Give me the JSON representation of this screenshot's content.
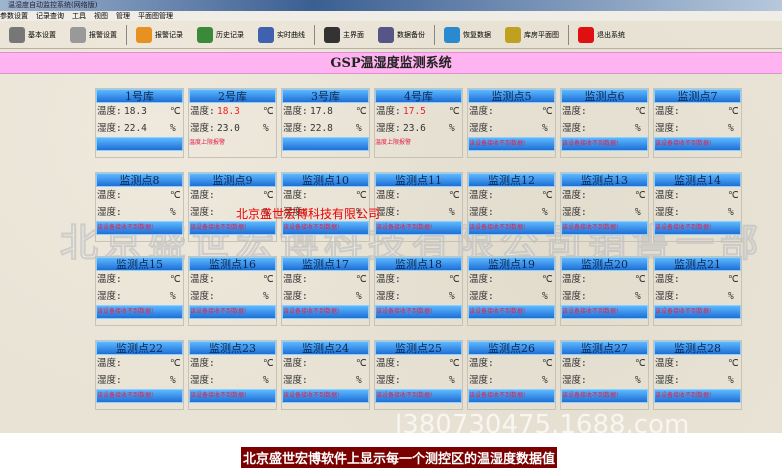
{
  "window": {
    "title": "温湿度自动监控系统(网络版)"
  },
  "menu": [
    "参数设置",
    "记录查询",
    "工具",
    "视图",
    "管理",
    "平面图管理"
  ],
  "toolbar": [
    {
      "label": "基本设置",
      "icon": "wrench-icon",
      "color": "#777"
    },
    {
      "label": "报警设置",
      "icon": "gear-icon",
      "color": "#999"
    },
    {
      "label": "报警记录",
      "icon": "alarm-icon",
      "color": "#e89020"
    },
    {
      "label": "历史记录",
      "icon": "history-search-icon",
      "color": "#3a8a3a"
    },
    {
      "label": "实时曲线",
      "icon": "curve-icon",
      "color": "#4060b0"
    },
    {
      "label": "主界面",
      "icon": "main-screen-icon",
      "color": "#333"
    },
    {
      "label": "数据备份",
      "icon": "backup-icon",
      "color": "#558"
    },
    {
      "label": "恢复数据",
      "icon": "restore-icon",
      "color": "#2a8ad0"
    },
    {
      "label": "库房平面图",
      "icon": "floorplan-icon",
      "color": "#c0a020"
    },
    {
      "label": "退出系统",
      "icon": "power-icon",
      "color": "#e01010"
    }
  ],
  "system_title": "GSP温湿度监测系统",
  "labels": {
    "temp": "温度:",
    "hum": "湿度:",
    "temp_unit": "℃",
    "hum_unit": "%"
  },
  "cards": [
    {
      "name": "1号库",
      "temp": "18.3",
      "hum": "22.4",
      "status": ""
    },
    {
      "name": "2号库",
      "temp": "18.3",
      "hum": "23.0",
      "status": "温度上限报警",
      "alarm": true
    },
    {
      "name": "3号库",
      "temp": "17.8",
      "hum": "22.8",
      "status": ""
    },
    {
      "name": "4号库",
      "temp": "17.5",
      "hum": "23.6",
      "status": "温度上限报警",
      "alarm": true
    },
    {
      "name": "监测点5",
      "status": "该设备接收不到数据!"
    },
    {
      "name": "监测点6",
      "status": "该设备接收不到数据!"
    },
    {
      "name": "监测点7",
      "status": "该设备接收不到数据!"
    },
    {
      "name": "监测点8",
      "status": "该设备接收不到数据!"
    },
    {
      "name": "监测点9",
      "status": "该设备接收不到数据!"
    },
    {
      "name": "监测点10",
      "status": "该设备接收不到数据!"
    },
    {
      "name": "监测点11",
      "status": "该设备接收不到数据!"
    },
    {
      "name": "监测点12",
      "status": "该设备接收不到数据!"
    },
    {
      "name": "监测点13",
      "status": "该设备接收不到数据!"
    },
    {
      "name": "监测点14",
      "status": "该设备接收不到数据!"
    },
    {
      "name": "监测点15",
      "status": "该设备接收不到数据!"
    },
    {
      "name": "监测点16",
      "status": "该设备接收不到数据!"
    },
    {
      "name": "监测点17",
      "status": "该设备接收不到数据!"
    },
    {
      "name": "监测点18",
      "status": "该设备接收不到数据!"
    },
    {
      "name": "监测点19",
      "status": "该设备接收不到数据!"
    },
    {
      "name": "监测点20",
      "status": "该设备接收不到数据!"
    },
    {
      "name": "监测点21",
      "status": "该设备接收不到数据!"
    },
    {
      "name": "监测点22",
      "status": "该设备接收不到数据!"
    },
    {
      "name": "监测点23",
      "status": "该设备接收不到数据!"
    },
    {
      "name": "监测点24",
      "status": "该设备接收不到数据!"
    },
    {
      "name": "监测点25",
      "status": "该设备接收不到数据!"
    },
    {
      "name": "监测点26",
      "status": "该设备接收不到数据!"
    },
    {
      "name": "监测点27",
      "status": "该设备接收不到数据!"
    },
    {
      "name": "监测点28",
      "status": "该设备接收不到数据!"
    }
  ],
  "watermarks": {
    "large": "北京盛世宏博科技有限公司销售一部",
    "red": "北京盛世宏博科技有限公司",
    "site": "l380730475.1688.com"
  },
  "caption": "北京盛世宏博软件上显示每一个测控区的温湿度数据值"
}
